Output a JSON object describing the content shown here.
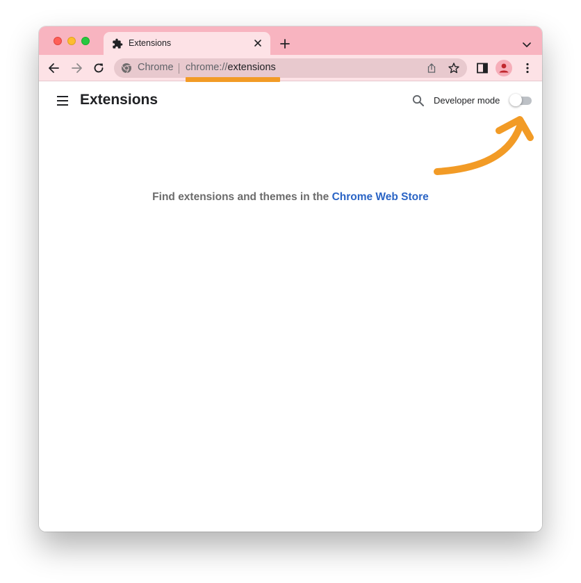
{
  "tab": {
    "title": "Extensions"
  },
  "omnibox": {
    "chip_label": "Chrome",
    "url_scheme": "chrome://",
    "url_path": "extensions"
  },
  "page": {
    "title": "Extensions",
    "developer_mode_label": "Developer mode",
    "developer_mode_enabled": false,
    "empty_message_prefix": "Find extensions and themes in the ",
    "empty_message_link": "Chrome Web Store"
  },
  "colors": {
    "tabstrip": "#f8b4c0",
    "toolbar": "#fde2e6",
    "link": "#2a64c5",
    "annotation": "#f29b26"
  },
  "icons": [
    "puzzle-icon",
    "close-icon",
    "plus-icon",
    "chevron-down-icon",
    "back-arrow-icon",
    "forward-arrow-icon",
    "reload-icon",
    "chrome-logo-icon",
    "share-icon",
    "star-icon",
    "side-panel-icon",
    "profile-icon",
    "more-vert-icon",
    "hamburger-menu-icon",
    "search-icon"
  ]
}
